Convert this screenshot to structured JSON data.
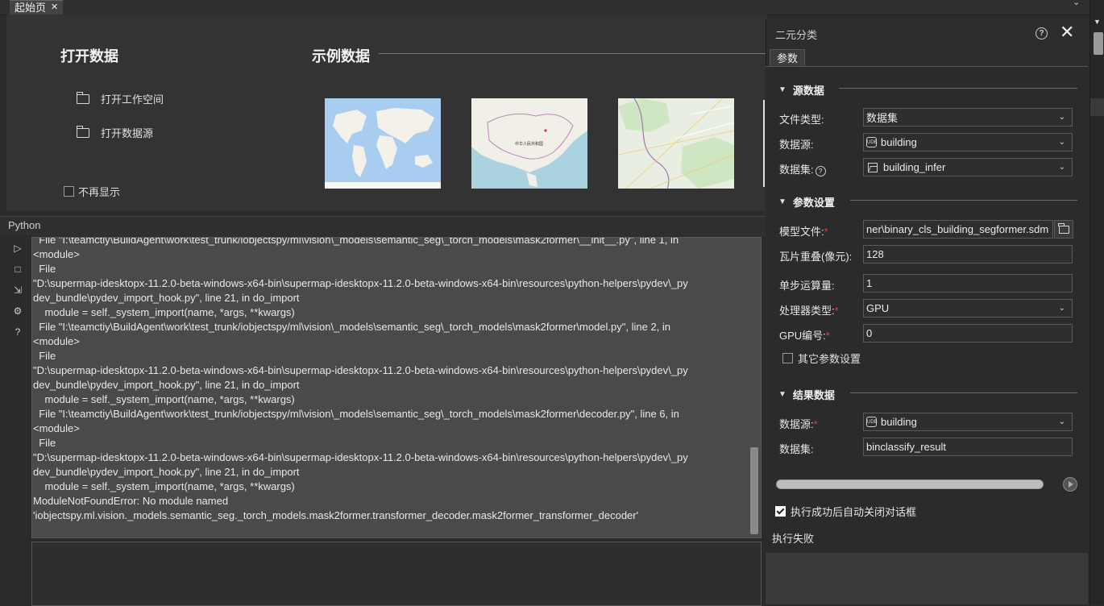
{
  "tabs": {
    "start_label": "起始页",
    "close_glyph": "✕",
    "overflow_glyph": "⌄"
  },
  "start_page": {
    "open_title": "打开数据",
    "open_items": [
      {
        "label": "打开工作空间",
        "icon": "folder-icon"
      },
      {
        "label": "打开数据源",
        "icon": "folder-icon"
      }
    ],
    "sample_title": "示例数据",
    "no_show_label": "不再显示",
    "map_labels": {
      "china": "中华人民共和国"
    }
  },
  "python": {
    "title": "Python",
    "toolbar_icons": [
      "run-icon",
      "stop-icon",
      "export-icon",
      "settings-icon",
      "help-icon"
    ],
    "console_text": "  File \"I:\\teamctiy\\BuildAgent\\work\\test_trunk/iobjectspy/ml\\vision\\_models\\semantic_seg\\_torch_models\\mask2former\\__init__.py\", line 1, in\n<module>\n  File\n\"D:\\supermap-idesktopx-11.2.0-beta-windows-x64-bin\\supermap-idesktopx-11.2.0-beta-windows-x64-bin\\resources\\python-helpers\\pydev\\_py\ndev_bundle\\pydev_import_hook.py\", line 21, in do_import\n    module = self._system_import(name, *args, **kwargs)\n  File \"I:\\teamctiy\\BuildAgent\\work\\test_trunk/iobjectspy/ml\\vision\\_models\\semantic_seg\\_torch_models\\mask2former\\model.py\", line 2, in\n<module>\n  File\n\"D:\\supermap-idesktopx-11.2.0-beta-windows-x64-bin\\supermap-idesktopx-11.2.0-beta-windows-x64-bin\\resources\\python-helpers\\pydev\\_py\ndev_bundle\\pydev_import_hook.py\", line 21, in do_import\n    module = self._system_import(name, *args, **kwargs)\n  File \"I:\\teamctiy\\BuildAgent\\work\\test_trunk/iobjectspy/ml\\vision\\_models\\semantic_seg\\_torch_models\\mask2former\\decoder.py\", line 6, in\n<module>\n  File\n\"D:\\supermap-idesktopx-11.2.0-beta-windows-x64-bin\\supermap-idesktopx-11.2.0-beta-windows-x64-bin\\resources\\python-helpers\\pydev\\_py\ndev_bundle\\pydev_import_hook.py\", line 21, in do_import\n    module = self._system_import(name, *args, **kwargs)\nModuleNotFoundError: No module named\n'iobjectspy.ml.vision._models.semantic_seg._torch_models.mask2former.transformer_decoder.mask2former_transformer_decoder'"
  },
  "dialog": {
    "title": "二元分类",
    "help_glyph": "?",
    "close_glyph": "✕",
    "tab_label": "参数",
    "source_section": {
      "title": "源数据",
      "file_type_label": "文件类型:",
      "file_type_value": "数据集",
      "datasource_label": "数据源:",
      "datasource_value": "building",
      "dataset_label": "数据集:",
      "dataset_value": "building_infer"
    },
    "param_section": {
      "title": "参数设置",
      "model_label": "模型文件:",
      "model_value": "ner\\binary_cls_building_segformer.sdm",
      "overlap_label": "瓦片重叠(像元):",
      "overlap_value": "128",
      "batch_label": "单步运算量:",
      "batch_value": "1",
      "processor_label": "处理器类型:",
      "processor_value": "GPU",
      "gpu_label": "GPU编号:",
      "gpu_value": "0",
      "other_label": "其它参数设置"
    },
    "result_section": {
      "title": "结果数据",
      "datasource_label": "数据源:",
      "datasource_value": "building",
      "dataset_label": "数据集:",
      "dataset_value": "binclassify_result"
    },
    "required_mark": "*",
    "autoclose_label": "执行成功后自动关闭对话框",
    "status_text": "执行失败",
    "progress": 0
  }
}
